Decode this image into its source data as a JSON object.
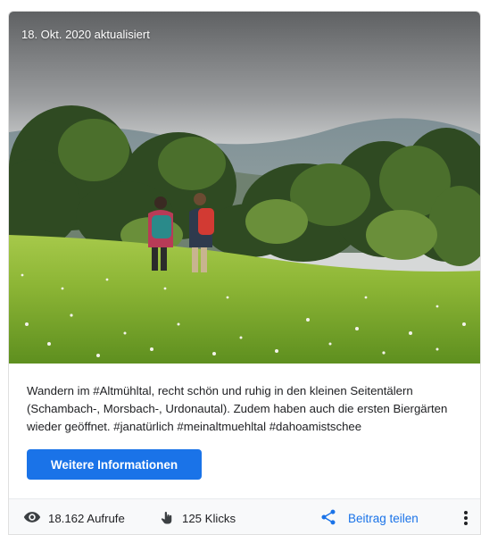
{
  "post": {
    "updated": "18. Okt. 2020 aktualisiert",
    "text": "Wandern im #Altmühltal, recht schön und ruhig in den kleinen Seitentälern (Schambach-, Morsbach-, Urdonautal). Zudem haben auch die ersten Biergärten wieder geöffnet. #janatürlich #meinaltmuehltal #dahoamistschee",
    "image_alt": "hikers-in-meadow-photo"
  },
  "button": {
    "label": "Weitere Informationen"
  },
  "stats": {
    "views_icon": "eye-icon",
    "views": "18.162 Aufrufe",
    "clicks_icon": "touch-hand-icon",
    "clicks": "125 Klicks"
  },
  "share": {
    "icon": "share-icon",
    "label": "Beitrag teilen"
  },
  "menu": {
    "icon": "more-vert-icon"
  },
  "colors": {
    "accent": "#1a73e8",
    "text": "#202124",
    "footer_bg": "#f8f9fa"
  }
}
